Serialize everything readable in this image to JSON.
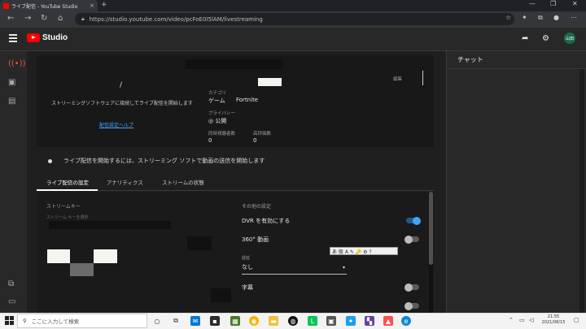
{
  "browser": {
    "tab_title": "ライブ配信 - YouTube Studio",
    "url": "https://studio.youtube.com/video/pcFoE0I5lAM/livestreaming"
  },
  "header": {
    "logo_text": "Studio",
    "avatar_text": "山田"
  },
  "preview": {
    "slash": "/",
    "instruction": "ストリーミングソフトウェアに接続してライブ配信を開始します",
    "help_link": "配信設定ヘルプ"
  },
  "stream_info": {
    "right_label": "編集",
    "category_label": "カテゴリ",
    "game_label": "ゲーム",
    "game_value": "Fortnite",
    "privacy_label": "プライバシー",
    "privacy_value": "公開",
    "viewers_label": "同時視聴者数",
    "viewers_value": "0",
    "likes_label": "高評価数",
    "likes_value": "0"
  },
  "notice": {
    "text": "ライブ配信を開始するには、ストリーミング ソフトで動画の送信を開始します"
  },
  "tabs": [
    {
      "label": "ライブ配信の設定"
    },
    {
      "label": "アナリティクス"
    },
    {
      "label": "ストリームの状態"
    }
  ],
  "stream_key": {
    "heading": "ストリームキー",
    "sub": "ストリーム キーを選択"
  },
  "settings": {
    "heading": "その他の設定",
    "dvr_label": "DVR を有効にする",
    "dvr_on": true,
    "v360_label": "360° 動画",
    "v360_on": false,
    "latency_label": "遅延",
    "latency_value": "なし",
    "subtitle_label": "字幕",
    "subtitle_on": false
  },
  "ime_bar": {
    "text": "あ 般 A ✎ 🔑 ⚙ ?"
  },
  "chat": {
    "title": "チャット"
  },
  "taskbar": {
    "search_placeholder": "ここに入力して検索",
    "clock_time": "21:55",
    "clock_date": "2021/08/15"
  }
}
